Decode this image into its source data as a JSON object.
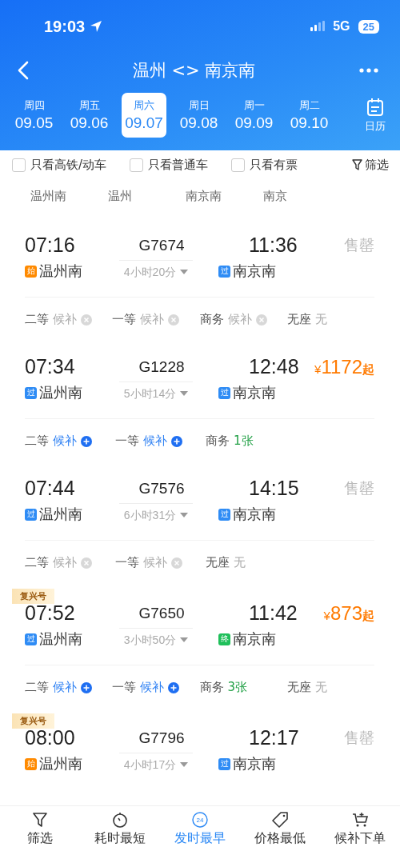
{
  "status_bar": {
    "time": "19:03",
    "network": "5G",
    "battery": "25"
  },
  "header": {
    "title": "温州 <> 南京南"
  },
  "dates": [
    {
      "weekday": "周四",
      "date": "09.05",
      "selected": false
    },
    {
      "weekday": "周五",
      "date": "09.06",
      "selected": false
    },
    {
      "weekday": "周六",
      "date": "09.07",
      "selected": true
    },
    {
      "weekday": "周日",
      "date": "09.08",
      "selected": false
    },
    {
      "weekday": "周一",
      "date": "09.09",
      "selected": false
    },
    {
      "weekday": "周二",
      "date": "09.10",
      "selected": false
    }
  ],
  "calendar_label": "日历",
  "filters": [
    {
      "label": "只看高铁/动车",
      "checked": false
    },
    {
      "label": "只看普通车",
      "checked": false
    },
    {
      "label": "只看有票",
      "checked": false
    }
  ],
  "filter_button": "筛选",
  "stations": [
    "温州南",
    "温州",
    "南京南",
    "南京"
  ],
  "trains": [
    {
      "depart": "07:16",
      "train_no": "G7674",
      "arrive": "11:36",
      "from_tag": {
        "kind": "start",
        "text": "始"
      },
      "from": "温州南",
      "duration": "4小时20分",
      "to_tag": {
        "kind": "pass",
        "text": "过"
      },
      "to": "南京南",
      "status": "售罄",
      "seats": [
        {
          "class": "二等",
          "status": "候补",
          "kind": "closed"
        },
        {
          "class": "一等",
          "status": "候补",
          "kind": "closed"
        },
        {
          "class": "商务",
          "status": "候补",
          "kind": "closed"
        },
        {
          "class": "无座",
          "status": "无",
          "kind": "none"
        }
      ]
    },
    {
      "depart": "07:34",
      "train_no": "G1228",
      "arrive": "12:48",
      "from_tag": {
        "kind": "pass",
        "text": "过"
      },
      "from": "温州南",
      "duration": "5小时14分",
      "to_tag": {
        "kind": "pass",
        "text": "过"
      },
      "to": "南京南",
      "price": {
        "currency": "¥",
        "amount": "1172",
        "suffix": "起"
      },
      "seats": [
        {
          "class": "二等",
          "status": "候补",
          "kind": "waitlist"
        },
        {
          "class": "一等",
          "status": "候补",
          "kind": "waitlist"
        },
        {
          "class": "商务",
          "status": "1张",
          "kind": "count"
        }
      ]
    },
    {
      "depart": "07:44",
      "train_no": "G7576",
      "arrive": "14:15",
      "from_tag": {
        "kind": "pass",
        "text": "过"
      },
      "from": "温州南",
      "duration": "6小时31分",
      "to_tag": {
        "kind": "pass",
        "text": "过"
      },
      "to": "南京南",
      "status": "售罄",
      "seats": [
        {
          "class": "二等",
          "status": "候补",
          "kind": "closed"
        },
        {
          "class": "一等",
          "status": "候补",
          "kind": "closed"
        },
        {
          "class": "无座",
          "status": "无",
          "kind": "none"
        }
      ]
    },
    {
      "badge": "复兴号",
      "depart": "07:52",
      "train_no": "G7650",
      "arrive": "11:42",
      "from_tag": {
        "kind": "pass",
        "text": "过"
      },
      "from": "温州南",
      "duration": "3小时50分",
      "to_tag": {
        "kind": "end",
        "text": "终"
      },
      "to": "南京南",
      "price": {
        "currency": "¥",
        "amount": "873",
        "suffix": "起"
      },
      "seats": [
        {
          "class": "二等",
          "status": "候补",
          "kind": "waitlist"
        },
        {
          "class": "一等",
          "status": "候补",
          "kind": "waitlist"
        },
        {
          "class": "商务",
          "status": "3张",
          "kind": "count"
        },
        {
          "class": "无座",
          "status": "无",
          "kind": "none"
        }
      ]
    },
    {
      "badge": "复兴号",
      "depart": "08:00",
      "train_no": "G7796",
      "arrive": "12:17",
      "from_tag": {
        "kind": "start",
        "text": "始"
      },
      "from": "温州南",
      "duration": "4小时17分",
      "to_tag": {
        "kind": "pass",
        "text": "过"
      },
      "to": "南京南",
      "status": "售罄"
    }
  ],
  "bottom_tabs": [
    {
      "kind": "filter",
      "label": "筛选",
      "selected": false
    },
    {
      "kind": "timer",
      "label": "耗时最短",
      "selected": false
    },
    {
      "kind": "clock24",
      "label": "发时最早",
      "selected": true,
      "icon_text": "24"
    },
    {
      "kind": "tag",
      "label": "价格最低",
      "selected": false
    },
    {
      "kind": "cart",
      "label": "候补下单",
      "selected": false
    }
  ]
}
